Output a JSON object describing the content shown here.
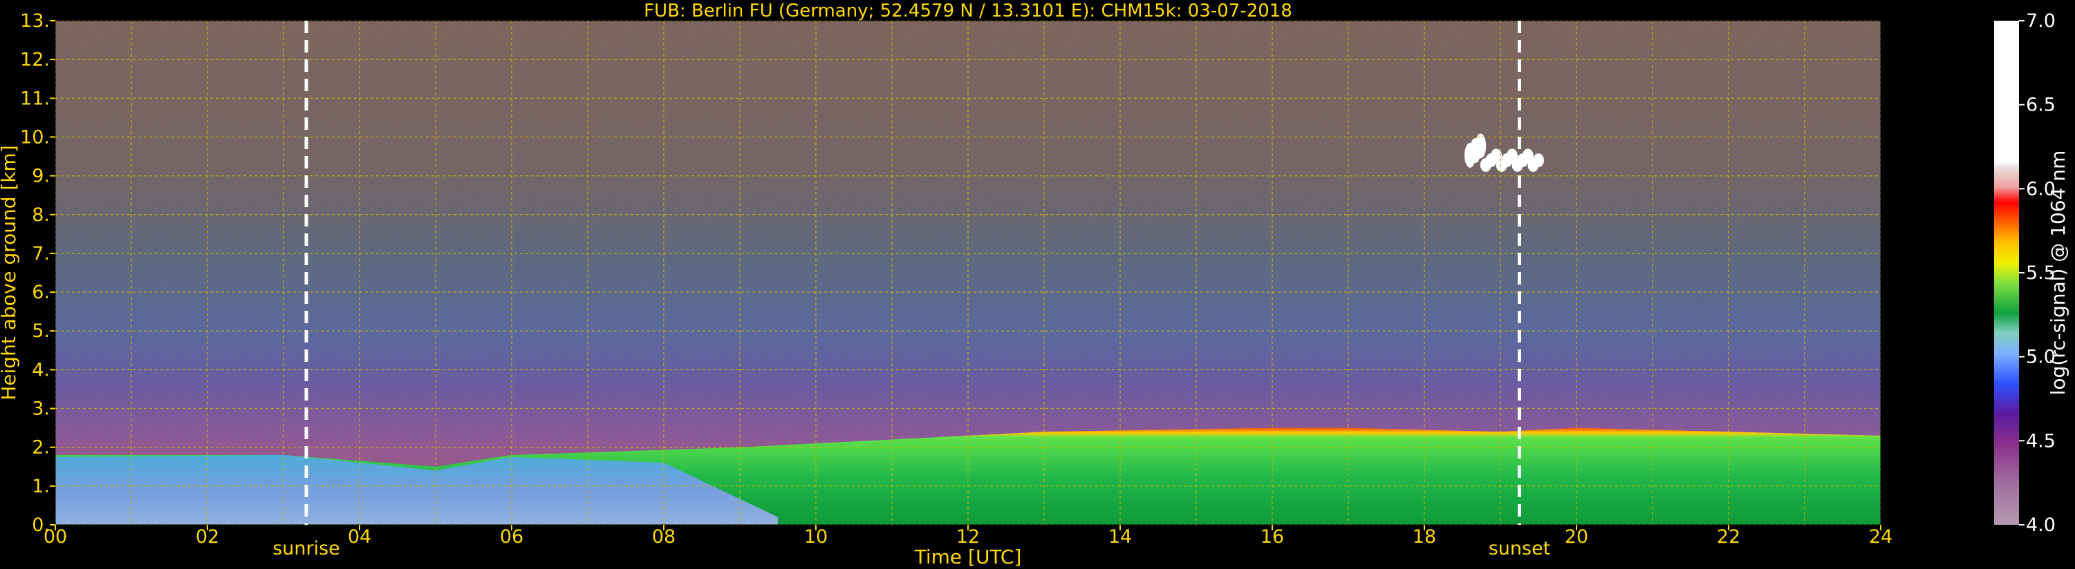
{
  "chart_data": {
    "type": "heatmap",
    "title": "FUB: Berlin FU (Germany; 52.4579 N / 13.3101 E):    CHM15k: 03-07-2018",
    "xlabel": "Time [UTC]",
    "ylabel": "Height above ground [km]",
    "xlim": [
      0,
      24
    ],
    "ylim": [
      0,
      13
    ],
    "x_ticks": [
      "00",
      "02",
      "04",
      "06",
      "08",
      "10",
      "12",
      "14",
      "16",
      "18",
      "20",
      "22",
      "24"
    ],
    "y_ticks": [
      "0.",
      "1.",
      "2.",
      "3.",
      "4.",
      "5.",
      "6.",
      "7.",
      "8.",
      "9.",
      "10.",
      "11.",
      "12.",
      "13."
    ],
    "grid": true,
    "annotations": [
      {
        "label": "sunrise",
        "x": 3.3
      },
      {
        "label": "sunset",
        "x": 19.25
      }
    ],
    "colorbar": {
      "label": "log(rc-signal) @ 1064 nm",
      "range": [
        4.0,
        7.0
      ],
      "ticks": [
        "4.0",
        "4.5",
        "5.0",
        "5.5",
        "6.0",
        "6.5",
        "7.0"
      ]
    },
    "features": [
      {
        "name": "boundary layer top",
        "times": [
          0,
          3,
          5,
          6,
          9,
          11,
          13,
          16,
          17,
          19,
          20,
          22,
          24
        ],
        "heights_km": [
          1.8,
          1.8,
          1.5,
          1.8,
          2.0,
          2.2,
          2.4,
          2.5,
          2.5,
          2.4,
          2.5,
          2.4,
          2.3
        ]
      },
      {
        "name": "cloud",
        "time_start": 18.6,
        "time_end": 19.5,
        "height_km": 9.4
      }
    ]
  },
  "colors": {
    "text": "#ffd800",
    "grid": "#c8b400",
    "background": "#000000",
    "cloud": "#ffffff"
  }
}
